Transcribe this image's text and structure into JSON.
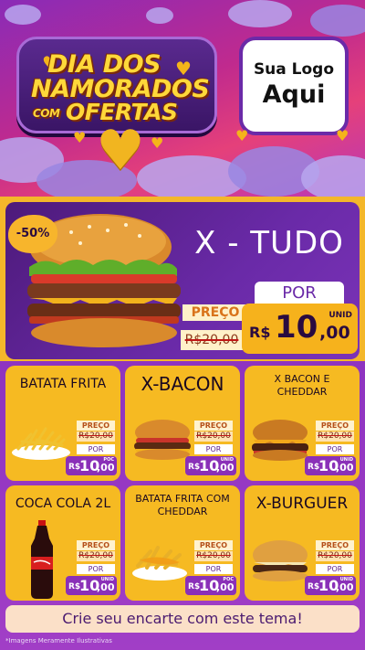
{
  "header": {
    "title_line1": "DIA DOS",
    "title_line2": "NAMORADOS",
    "title_small": "COM",
    "title_line3": "OFERTAS",
    "logo_line1": "Sua Logo",
    "logo_line2": "Aqui",
    "heart_icon": "♥"
  },
  "hero": {
    "discount": "-50%",
    "title": "X - TUDO",
    "price_label": "PREÇO",
    "old_price": "R$20,00",
    "por_label": "POR",
    "currency": "R$",
    "price_int": "10",
    "price_dec": ",00",
    "unit": "UNID"
  },
  "products": [
    {
      "title": "BATATA FRITA",
      "price_label": "PREÇO",
      "old_price": "R$20,00",
      "por_label": "POR",
      "currency": "R$",
      "price_int": "10",
      "price_dec": ",00",
      "unit": "POC"
    },
    {
      "title": "X-BACON",
      "price_label": "PREÇO",
      "old_price": "R$20,00",
      "por_label": "POR",
      "currency": "R$",
      "price_int": "10",
      "price_dec": ",00",
      "unit": "UNID"
    },
    {
      "title": "X BACON E CHEDDAR",
      "price_label": "PREÇO",
      "old_price": "R$20,00",
      "por_label": "POR",
      "currency": "R$",
      "price_int": "10",
      "price_dec": ",00",
      "unit": "UNID"
    },
    {
      "title": "COCA COLA 2L",
      "price_label": "PREÇO",
      "old_price": "R$20,00",
      "por_label": "POR",
      "currency": "R$",
      "price_int": "10",
      "price_dec": ",00",
      "unit": "UNID"
    },
    {
      "title": "BATATA FRITA COM CHEDDAR",
      "price_label": "PREÇO",
      "old_price": "R$20,00",
      "por_label": "POR",
      "currency": "R$",
      "price_int": "10",
      "price_dec": ",00",
      "unit": "POC"
    },
    {
      "title": "X-BURGUER",
      "price_label": "PREÇO",
      "old_price": "R$20,00",
      "por_label": "POR",
      "currency": "R$",
      "price_int": "10",
      "price_dec": ",00",
      "unit": "UNID"
    }
  ],
  "cta": "Crie seu encarte com este tema!",
  "footnote": "*Imagens Meramente Ilustrativas",
  "colors": {
    "accent_yellow": "#f6ba22",
    "purple": "#8a30b8",
    "pink": "#e5407a"
  }
}
